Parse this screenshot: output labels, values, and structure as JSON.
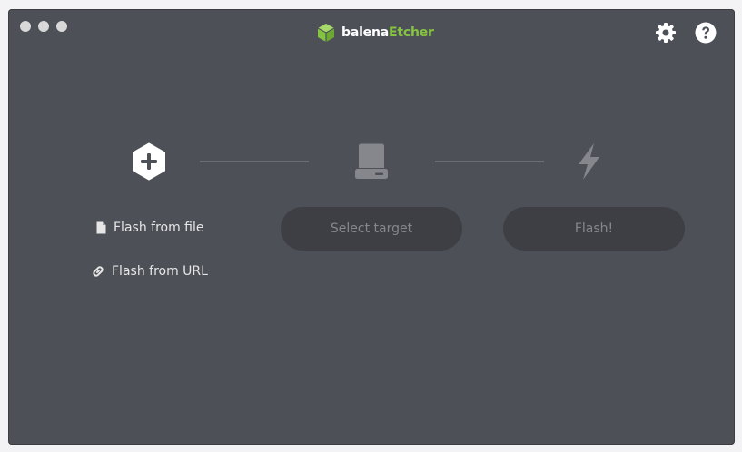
{
  "app": {
    "brand_prefix": "balena",
    "brand_suffix": "Etcher",
    "brand_accent": "#85c441"
  },
  "toolbar": {
    "settings_icon": "gear-icon",
    "help_icon": "question-circle-icon"
  },
  "steps": {
    "source_icon": "hexagon-plus-icon",
    "target_icon": "drive-icon",
    "flash_icon": "lightning-icon"
  },
  "source": {
    "flash_from_file_label": "Flash from file",
    "flash_from_url_label": "Flash from URL"
  },
  "target": {
    "select_target_label": "Select target"
  },
  "flash": {
    "flash_label": "Flash!"
  },
  "colors": {
    "window_bg": "#4d5057",
    "disabled_button_bg": "#3d3f44",
    "disabled_text": "#85878c"
  }
}
